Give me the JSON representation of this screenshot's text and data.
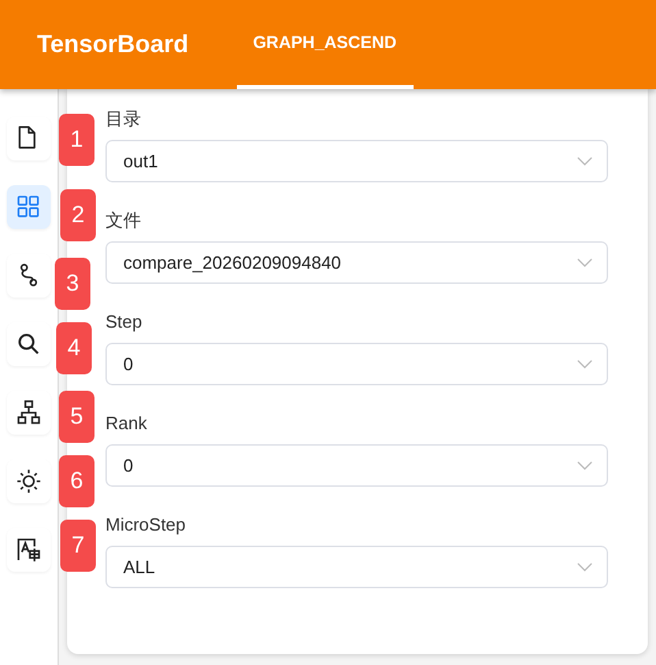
{
  "header": {
    "title": "TensorBoard",
    "tabs": [
      {
        "label": "GRAPH_ASCEND",
        "selected": true
      }
    ]
  },
  "sidebar": {
    "items": [
      {
        "kind": "file",
        "selected": false
      },
      {
        "kind": "grid",
        "selected": true
      },
      {
        "kind": "path",
        "selected": false
      },
      {
        "kind": "search",
        "selected": false
      },
      {
        "kind": "hierarchy",
        "selected": false
      },
      {
        "kind": "sun",
        "selected": false
      },
      {
        "kind": "translate",
        "selected": false
      }
    ]
  },
  "fields": [
    {
      "label": "目录",
      "value": "out1"
    },
    {
      "label": "文件",
      "value": "compare_20260209094840"
    },
    {
      "label": "Step",
      "value": "0"
    },
    {
      "label": "Rank",
      "value": "0"
    },
    {
      "label": "MicroStep",
      "value": "ALL"
    }
  ],
  "badges": [
    "1",
    "2",
    "3",
    "4",
    "5",
    "6",
    "7"
  ]
}
